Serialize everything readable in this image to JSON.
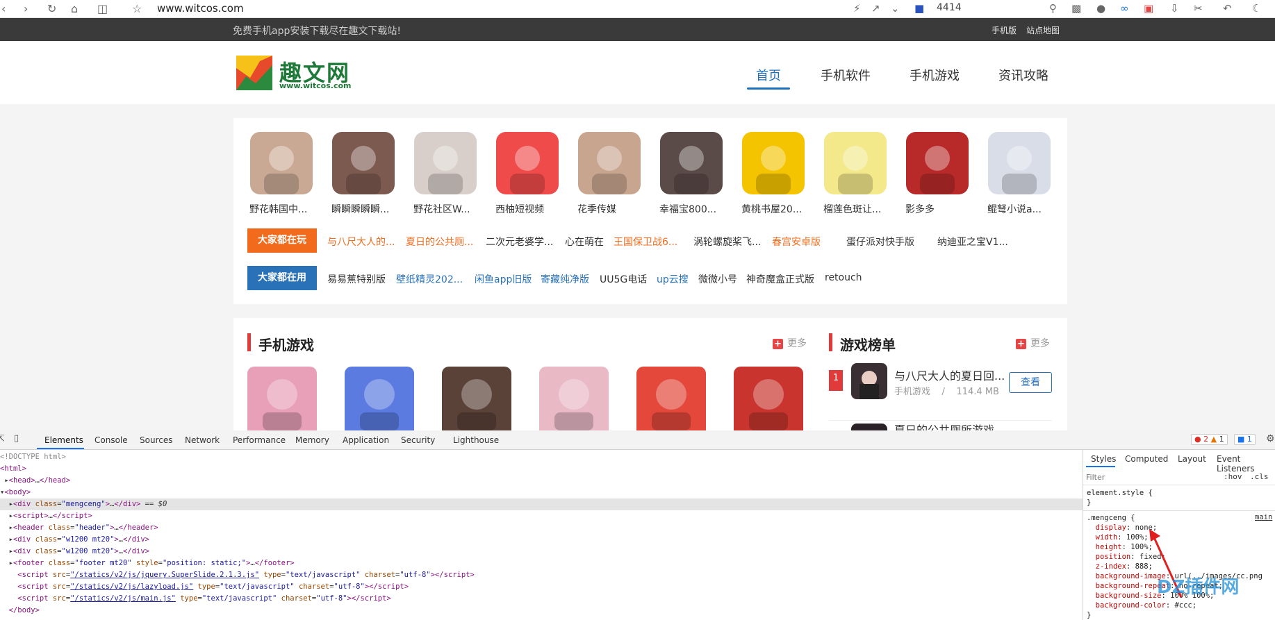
{
  "browser": {
    "url": "www.witcos.com",
    "counter": "4414",
    "icons": [
      "back-icon",
      "forward-icon",
      "reload-icon",
      "home-icon",
      "reader-icon",
      "star-icon"
    ]
  },
  "topstrip": {
    "notice": "免费手机app安装下载尽在趣文下载站!",
    "links": [
      "手机版",
      "站点地图"
    ]
  },
  "header": {
    "logo_text": "趣文网",
    "logo_sub": "www.witcos.com",
    "nav": [
      "首页",
      "手机软件",
      "手机游戏",
      "资讯攻略"
    ],
    "active_nav": "首页"
  },
  "apps": [
    {
      "name": "野花韩国中...",
      "color": "#c9a994"
    },
    {
      "name": "瞬瞬瞬瞬瞬...",
      "color": "#7d5a50"
    },
    {
      "name": "野花社区W...",
      "color": "#d8cfca"
    },
    {
      "name": "西柚短视频",
      "color": "#f04b4b"
    },
    {
      "name": "花季传媒",
      "color": "#c8a58e"
    },
    {
      "name": "幸福宝800...",
      "color": "#5a4a48"
    },
    {
      "name": "黄桃书屋20...",
      "color": "#f5c400"
    },
    {
      "name": "榴莲色斑让...",
      "color": "#f3e88a"
    },
    {
      "name": "影多多",
      "color": "#b82a2a"
    },
    {
      "name": "鲲弩小说a...",
      "color": "#d9dde8"
    }
  ],
  "row_play": {
    "tag": "大家都在玩",
    "tag_color": "#f26b1d",
    "links": [
      {
        "text": "与八尺大人的...",
        "color": "#f26b1d"
      },
      {
        "text": "夏日的公共厕...",
        "color": "#f26b1d"
      },
      {
        "text": "二次元老婆学...",
        "color": "#333333"
      },
      {
        "text": "心在萌在",
        "color": "#333333"
      },
      {
        "text": "王国保卫战6...",
        "color": "#f26b1d"
      },
      {
        "text": "涡轮螺旋桨飞...",
        "color": "#333333"
      },
      {
        "text": "春宫安卓版",
        "color": "#f26b1d"
      },
      {
        "text": "蛋仔派对快手版",
        "color": "#333333"
      },
      {
        "text": "纳迪亚之宝V1...",
        "color": "#333333"
      }
    ]
  },
  "row_use": {
    "tag": "大家都在用",
    "tag_color": "#2a72b8",
    "links": [
      {
        "text": "易易蕉特别版",
        "color": "#333333"
      },
      {
        "text": "壁纸精灵202...",
        "color": "#2a72b8"
      },
      {
        "text": "闲鱼app旧版",
        "color": "#2a72b8"
      },
      {
        "text": "寄藏纯净版",
        "color": "#2a72b8"
      },
      {
        "text": "UU5G电话",
        "color": "#333333"
      },
      {
        "text": "up云搜",
        "color": "#2a72b8"
      },
      {
        "text": "微微小号",
        "color": "#333333"
      },
      {
        "text": "神奇魔盒正式版",
        "color": "#333333"
      },
      {
        "text": "retouch",
        "color": "#333333"
      }
    ]
  },
  "games_section": {
    "title": "手机游戏",
    "more": "更多",
    "thumbs": [
      "#e8a0b8",
      "#5b7be0",
      "#5a4238",
      "#e9b9c6",
      "#e3483a",
      "#c9352e"
    ]
  },
  "rank_section": {
    "title": "游戏榜单",
    "more": "更多",
    "item": {
      "rank": "1",
      "title": "与八尺大人的夏日回...",
      "category": "手机游戏",
      "separator": "/",
      "size": "114.4 MB",
      "button": "查看"
    },
    "next_item_partial": "夏日的公共厕所游戏"
  },
  "devtools": {
    "tabs": [
      "Elements",
      "Console",
      "Sources",
      "Network",
      "Performance",
      "Memory",
      "Application",
      "Security",
      "Lighthouse"
    ],
    "active_tab": "Elements",
    "errors": "2",
    "warnings": "1",
    "messages": "1",
    "styles_tabs": [
      "Styles",
      "Computed",
      "Layout",
      "Event Listeners"
    ],
    "filter_placeholder": "Filter",
    "hov": ":hov",
    "cls": ".cls",
    "element_style": "element.style {",
    "close_brace": "}",
    "rule_selector": ".mengceng {",
    "rule_source": "main",
    "css_props": [
      {
        "prop": "display",
        "value": "none;"
      },
      {
        "prop": "width",
        "value": "100%;"
      },
      {
        "prop": "height",
        "value": "100%;"
      },
      {
        "prop": "position",
        "value": "fixed;"
      },
      {
        "prop": "z-index",
        "value": "888;"
      },
      {
        "prop": "background-image",
        "value": "url(../images/cc.png"
      },
      {
        "prop": "background-repeat",
        "value": "no-repeat;"
      },
      {
        "prop": "background-size",
        "value": "100% 100%;"
      },
      {
        "prop": "background-color",
        "value": "#ccc;"
      }
    ]
  },
  "watermark": "DZ插件网"
}
